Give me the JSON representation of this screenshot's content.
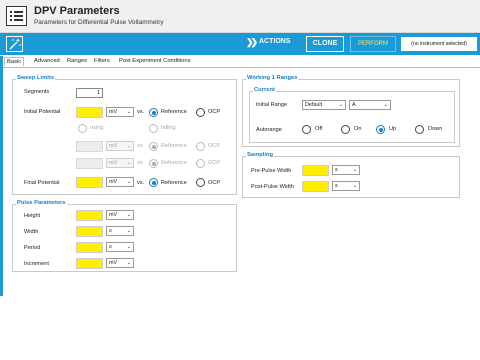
{
  "header": {
    "title": "DPV Parameters",
    "subtitle": "Parameters for Differential Pulse Voltammetry"
  },
  "toolbar": {
    "actions_label": "ACTIONS",
    "clone_label": "CLONE",
    "perform_label": "PERFORM",
    "instrument_label": "(no instrument selected)"
  },
  "tabs": [
    "Basic",
    "Advanced",
    "Ranges",
    "Filters",
    "Post Experiment Conditions"
  ],
  "sweep": {
    "title": "Sweep Limits",
    "segments_label": "Segments",
    "segments_value": "1",
    "initial_label": "Initial Potential",
    "final_label": "Final Potential",
    "unit": "mV",
    "vs": "vs.",
    "reference": "Reference",
    "ocp": "OCP",
    "rising": "rising",
    "falling": "falling"
  },
  "pulse": {
    "title": "Pulse Parameters",
    "rows": [
      {
        "label": "Height",
        "unit": "mV"
      },
      {
        "label": "Width",
        "unit": "s"
      },
      {
        "label": "Period",
        "unit": "s"
      },
      {
        "label": "Increment",
        "unit": "mV"
      }
    ]
  },
  "ranges": {
    "title": "Working 1 Ranges",
    "current_title": "Current",
    "initial_range_label": "Initial Range",
    "initial_range_value": "Default",
    "initial_range_unit": "A",
    "autorange_label": "Autorange",
    "options": [
      "Off",
      "On",
      "Up",
      "Down"
    ],
    "selected": "Up"
  },
  "sampling": {
    "title": "Sampling",
    "pre_label": "Pre-Pulse Width",
    "post_label": "Post-Pulse Width",
    "unit": "s"
  },
  "colors": {
    "accent": "#1a9ad6",
    "input_highlight": "#ffee00"
  }
}
